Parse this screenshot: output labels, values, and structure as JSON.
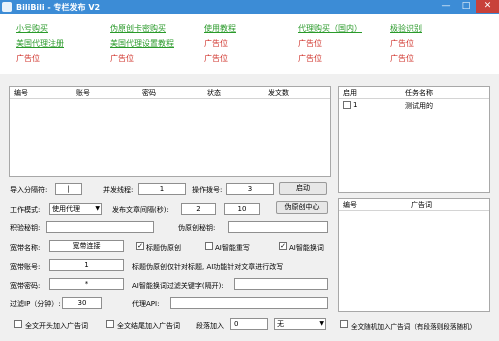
{
  "window": {
    "title": "BiliBili - 专栏发布 V2",
    "btn_min": "—",
    "btn_max": "□",
    "btn_close": "✕"
  },
  "links": [
    {
      "text": "小号购买",
      "color": "green"
    },
    {
      "text": "伪原创卡密购买",
      "color": "green"
    },
    {
      "text": "使用教程",
      "color": "green"
    },
    {
      "text": "代理购买（国内）",
      "color": "green"
    },
    {
      "text": "极验识别",
      "color": "green"
    },
    {
      "text": "美国代理注册",
      "color": "green"
    },
    {
      "text": "美国代理设置教程",
      "color": "green"
    },
    {
      "text": "广告位",
      "color": "red"
    },
    {
      "text": "广告位",
      "color": "red"
    },
    {
      "text": "广告位",
      "color": "red"
    },
    {
      "text": "广告位",
      "color": "red"
    },
    {
      "text": "广告位",
      "color": "red"
    },
    {
      "text": "广告位",
      "color": "red"
    },
    {
      "text": "广告位",
      "color": "red"
    },
    {
      "text": "广告位",
      "color": "red"
    }
  ],
  "accounts_table": {
    "columns": [
      "编号",
      "账号",
      "密码",
      "状态",
      "发文数"
    ]
  },
  "tasks_table": {
    "columns": [
      "启用",
      "任务名称"
    ],
    "rows": [
      {
        "id": "1",
        "name": "测试用的",
        "checked": false
      }
    ]
  },
  "ads_table": {
    "columns": [
      "编号",
      "广告词"
    ]
  },
  "form": {
    "import_sep_label": "导入分隔符:",
    "import_sep_value": "|",
    "threads_label": "并发线程:",
    "threads_value": "1",
    "op_num_label": "操作拨号:",
    "op_num_value": "3",
    "start_btn": "启动",
    "mode_label": "工作模式:",
    "mode_value": "使用代理",
    "interval_label": "发布文章间隔(秒):",
    "interval_min": "2",
    "interval_max": "10",
    "pseudo_center_btn": "伪原创中心",
    "captcha_label": "积验秘钥:",
    "pseudo_key_label": "伪原创秘钥:",
    "dial_name_label": "宽带名称:",
    "dial_name_value": "宽带连接",
    "cb_title_pseudo": "标题伪原创",
    "cb_ai_rewrite": "AI智能重写",
    "cb_ai_replace": "AI智能换词",
    "dial_account_label": "宽带账号:",
    "dial_account_value": "1",
    "title_note": "标题伪原创仅针对标题, AI功能针对文章进行改写",
    "dial_pwd_label": "宽带密码:",
    "dial_pwd_value": "*",
    "filter_label": "AI智能换词过滤关键字(隔开):",
    "proxy_ip_label": "过滤IP（分钟）:",
    "proxy_ip_value": "30",
    "proxy_api_label": "代理API:",
    "cb_head_ad": "全文开头加入广告词",
    "cb_tail_ad": "全文结尾加入广告词",
    "para_insert_label": "段落加入",
    "para_insert_value": "0",
    "para_select_value": "无",
    "cb_random_ad": "全文随机加入广告词（有段落则段落随机）"
  },
  "colors": {
    "title_bar": "#3c8cd6",
    "link_green": "#2a9a2a",
    "link_red": "#d0342c"
  }
}
